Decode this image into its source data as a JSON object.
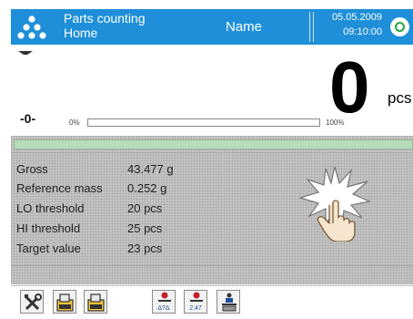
{
  "header": {
    "mode_title": "Parts counting",
    "mode_subtitle": "Home",
    "user_name": "Name",
    "date": "05.05.2009",
    "time": "09:10:00",
    "icons": [
      "parts-counting-icon",
      "status-ring-icon"
    ]
  },
  "display": {
    "value": "0",
    "unit": "pcs",
    "zero_indicator": "-0-",
    "progress_min_label": "0%",
    "progress_max_label": "100%",
    "progress_fraction": 0
  },
  "info": {
    "rows": [
      {
        "label": "Gross",
        "value": "43.477 g"
      },
      {
        "label": "Reference mass",
        "value": "0.252 g"
      },
      {
        "label": "LO threshold",
        "value": "20 pcs"
      },
      {
        "label": "HI threshold",
        "value": "25 pcs"
      },
      {
        "label": "Target value",
        "value": "23 pcs"
      }
    ]
  },
  "toolbar": {
    "buttons": [
      {
        "name": "settings-tools-icon"
      },
      {
        "name": "database-product-icon"
      },
      {
        "name": "database-edit-icon"
      },
      {
        "name": "thresholds-icon",
        "label": "Δ?Δ"
      },
      {
        "name": "target-value-icon",
        "label": "2.47"
      },
      {
        "name": "reference-sample-icon"
      }
    ]
  },
  "colors": {
    "header": "#1e8fd8",
    "panel": "#c5c5c5",
    "accent_green": "#2aa33b"
  }
}
